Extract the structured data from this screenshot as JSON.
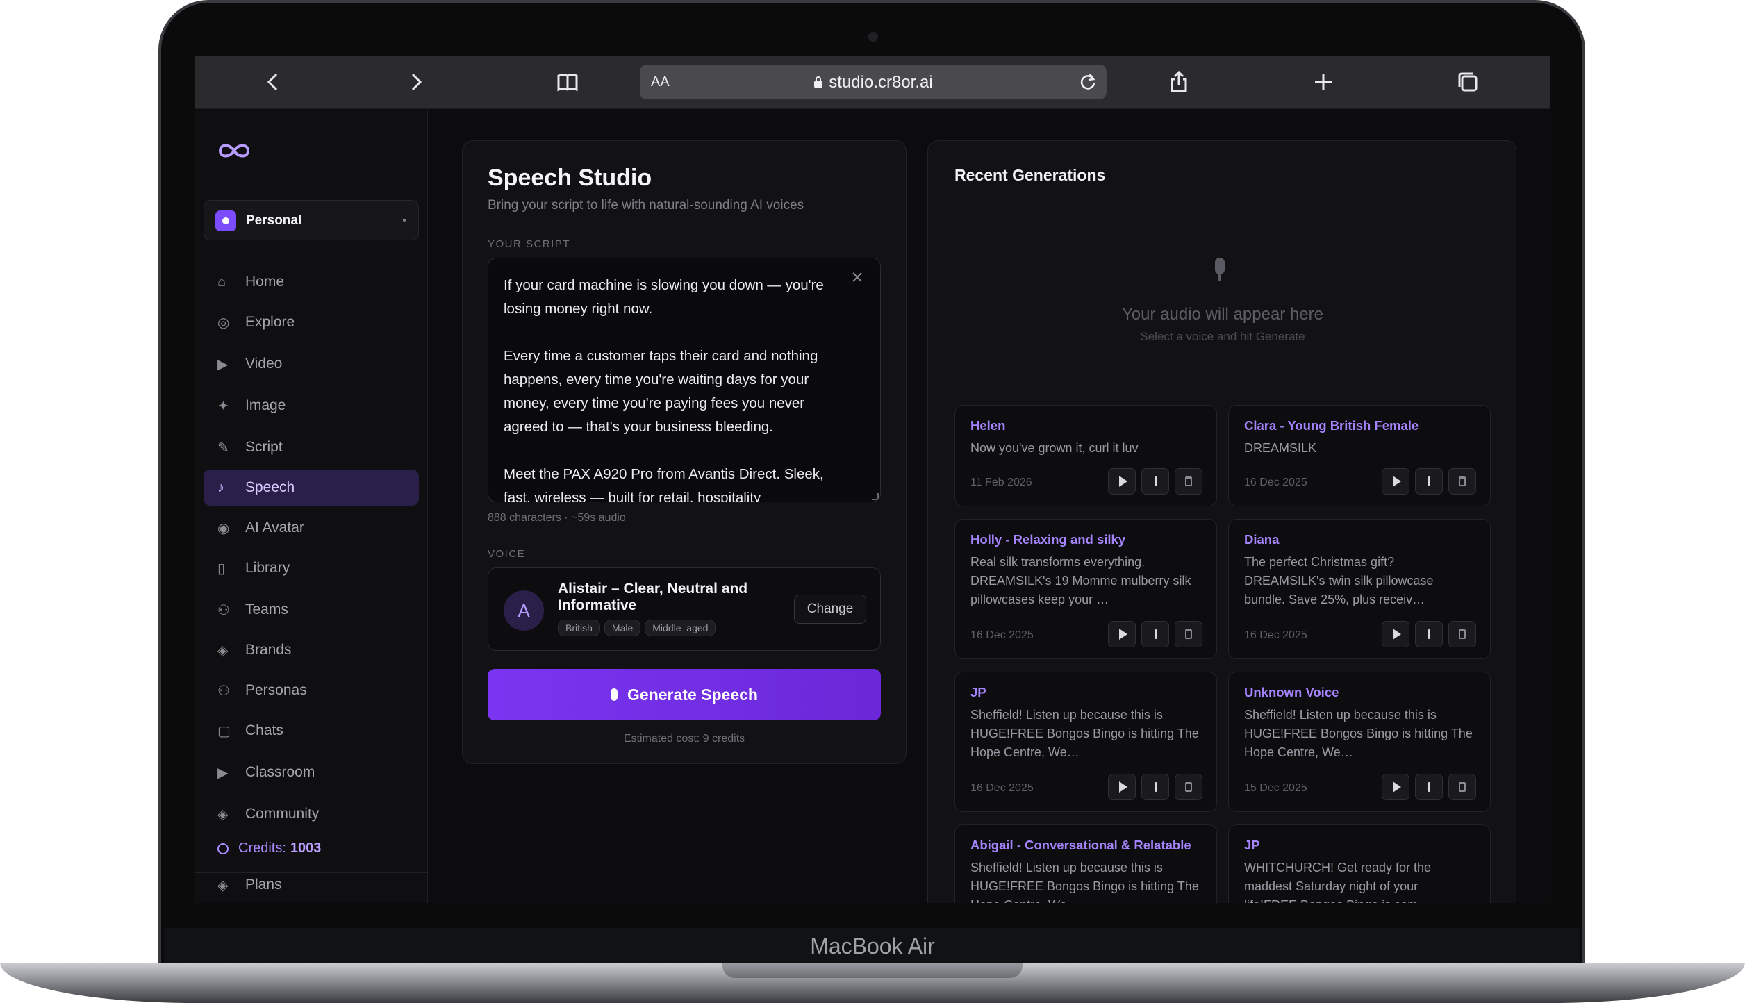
{
  "device": {
    "brand": "MacBook Air"
  },
  "browser": {
    "aa_label": "AA",
    "url": "studio.cr8or.ai"
  },
  "sidebar": {
    "workspace": "Personal",
    "items": [
      {
        "label": "Home",
        "icon": "home-icon",
        "glyph": "⌂"
      },
      {
        "label": "Explore",
        "icon": "compass-icon",
        "glyph": "◎"
      },
      {
        "label": "Video",
        "icon": "play-icon",
        "glyph": "▶"
      },
      {
        "label": "Image",
        "icon": "sparkle-icon",
        "glyph": "✦"
      },
      {
        "label": "Script",
        "icon": "pen-icon",
        "glyph": "✎"
      },
      {
        "label": "Speech",
        "icon": "music-note-icon",
        "glyph": "♪"
      },
      {
        "label": "AI Avatar",
        "icon": "avatar-icon",
        "glyph": "◉"
      },
      {
        "label": "Library",
        "icon": "book-icon",
        "glyph": "▯"
      },
      {
        "label": "Teams",
        "icon": "users-icon",
        "glyph": "⚇"
      },
      {
        "label": "Brands",
        "icon": "diamond-icon",
        "glyph": "◈"
      },
      {
        "label": "Personas",
        "icon": "persona-icon",
        "glyph": "⚇"
      },
      {
        "label": "Chats",
        "icon": "chat-icon",
        "glyph": "▢"
      },
      {
        "label": "Classroom",
        "icon": "classroom-icon",
        "glyph": "▶"
      },
      {
        "label": "Community",
        "icon": "community-icon",
        "glyph": "◈"
      }
    ],
    "active": "Speech",
    "credits_label": "Credits:",
    "credits_value": "1003",
    "plans_label": "Plans",
    "plans_glyph": "◈"
  },
  "studio": {
    "title": "Speech Studio",
    "subtitle": "Bring your script to life with natural-sounding AI voices",
    "script_label": "YOUR SCRIPT",
    "script_text": "If your card machine is slowing you down — you're losing money right now.\n\nEvery time a customer taps their card and nothing happens, every time you're waiting days for your money, every time you're paying fees you never agreed to — that's your business bleeding.\n\nMeet the PAX A920 Pro from Avantis Direct. Sleek, fast, wireless — built for retail, hospitality",
    "script_meta": "888 characters · ~59s audio",
    "voice_label": "VOICE",
    "voice": {
      "initial": "A",
      "name": "Alistair – Clear, Neutral and Informative",
      "tags": [
        "British",
        "Male",
        "Middle_aged"
      ],
      "change_label": "Change"
    },
    "generate_label": "Generate Speech",
    "estimated_cost": "Estimated cost: 9 credits"
  },
  "recent": {
    "title": "Recent Generations",
    "empty_title": "Your audio will appear here",
    "empty_subtitle": "Select a voice and hit Generate",
    "cards": [
      {
        "name": "Helen",
        "text": "Now you've grown it, curl it luv",
        "date": "11 Feb 2026"
      },
      {
        "name": "Clara - Young British Female",
        "text": "DREAMSILK",
        "date": "16 Dec 2025"
      },
      {
        "name": "Holly - Relaxing and silky",
        "text": "Real silk transforms everything. DREAMSILK's 19 Momme mulberry silk pillowcases keep your …",
        "date": "16 Dec 2025"
      },
      {
        "name": "Diana",
        "text": "The perfect Christmas gift? DREAMSILK's twin silk pillowcase bundle. Save 25%, plus receiv…",
        "date": "16 Dec 2025"
      },
      {
        "name": "JP",
        "text": "Sheffield! Listen up because this is HUGE!FREE Bongos Bingo is hitting The Hope Centre, We…",
        "date": "16 Dec 2025"
      },
      {
        "name": "Unknown Voice",
        "text": "Sheffield! Listen up because this is HUGE!FREE Bongos Bingo is hitting The Hope Centre, We…",
        "date": "15 Dec 2025"
      },
      {
        "name": "Abigail - Conversational & Relatable",
        "text": "Sheffield! Listen up because this is HUGE!FREE Bongos Bingo is hitting The Hope Centre, We…",
        "date": ""
      },
      {
        "name": "JP",
        "text": "WHITCHURCH! Get ready for the maddest Saturday night of your life!FREE Bongos Bingo is com…",
        "date": ""
      }
    ]
  },
  "colors": {
    "accent": "#7a35f0",
    "accent_text": "#a684ff",
    "background": "#0c0c0e"
  }
}
